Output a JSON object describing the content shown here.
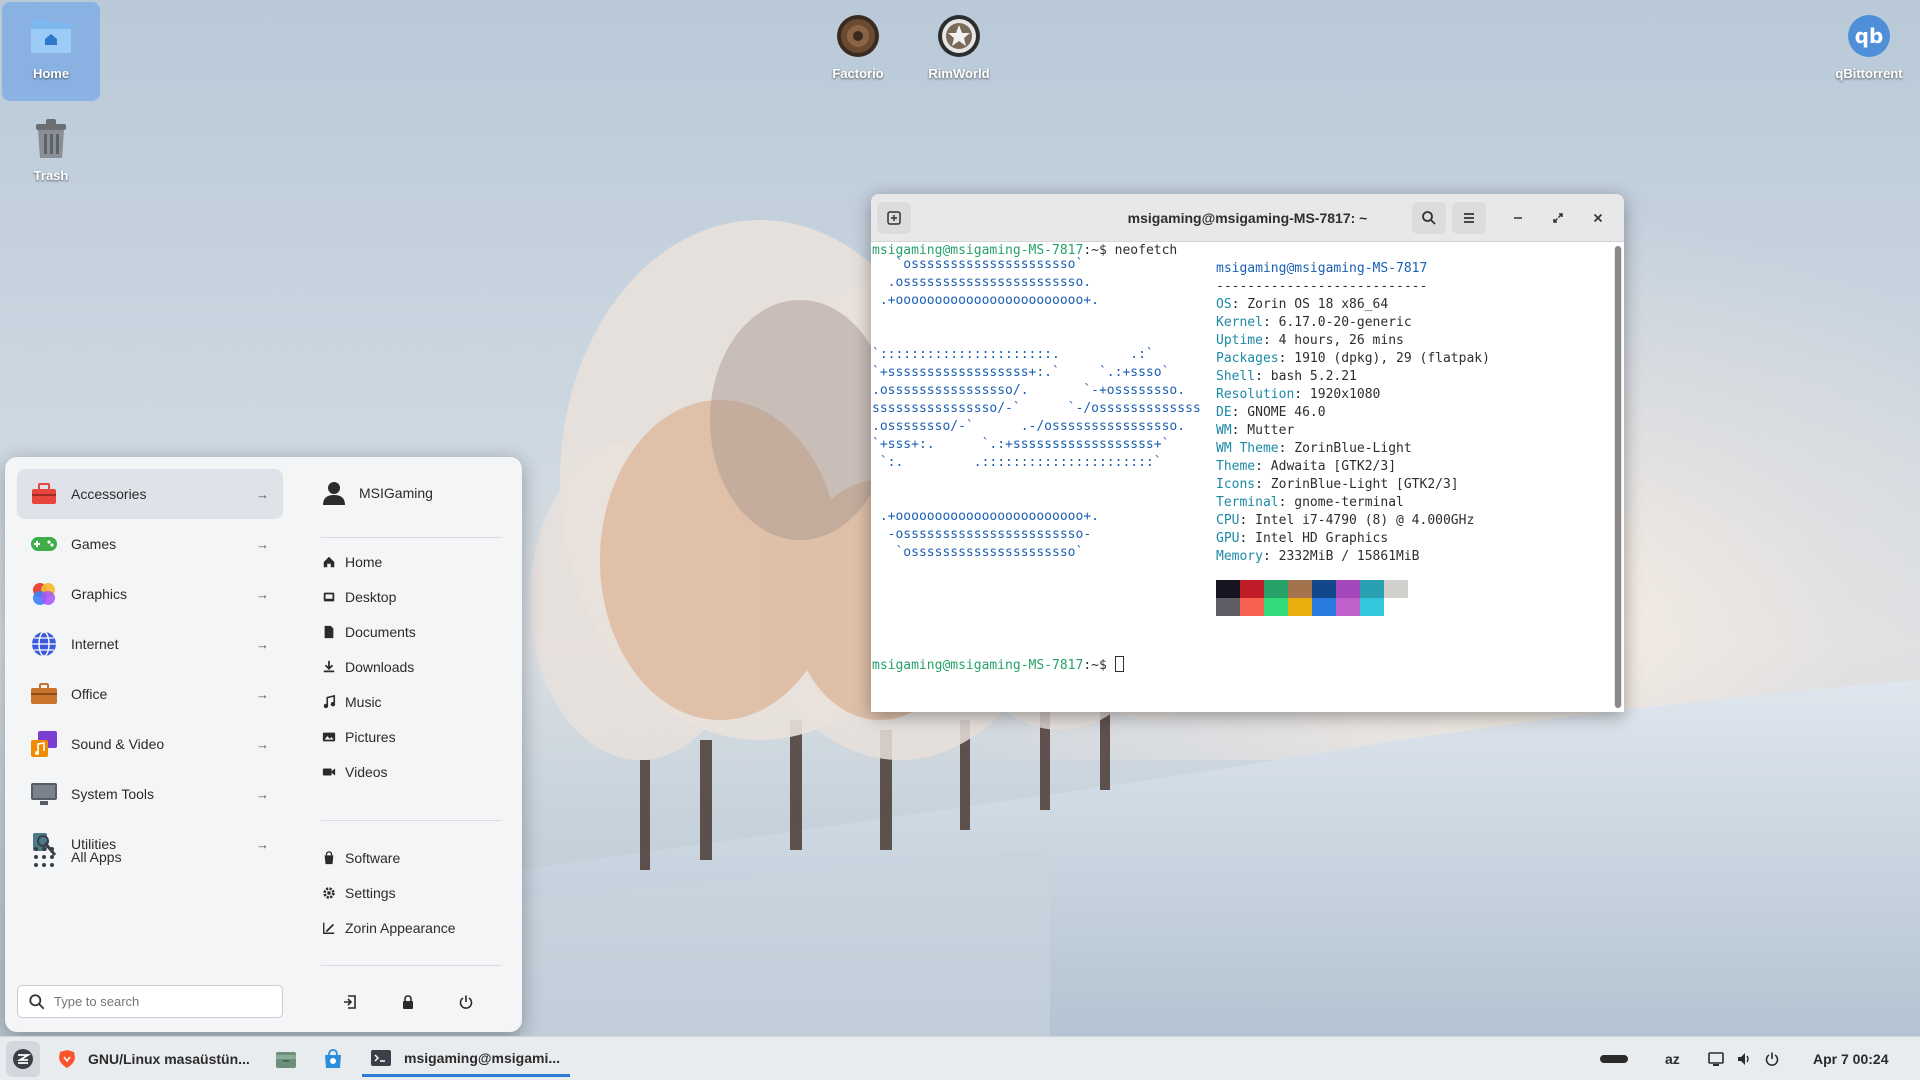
{
  "desktop": {
    "icons": [
      {
        "label": "Home",
        "selected": true
      },
      {
        "label": "Trash"
      },
      {
        "label": "Factorio"
      },
      {
        "label": "RimWorld"
      },
      {
        "label": "qBittorrent"
      }
    ]
  },
  "terminal": {
    "title": "msigaming@msigaming-MS-7817: ~",
    "prompt_user": "msigaming@msigaming-MS-7817",
    "prompt_suffix": ":~$",
    "command": " neofetch",
    "logo_lines": [
      "   `osssssssssssssssssssso`",
      "  .osssssssssssssssssssssso.",
      " .+oooooooooooooooooooooooo+.",
      "",
      "",
      "`::::::::::::::::::::::.         .:`",
      "`+ssssssssssssssssss+:.`     `.:+ssso`",
      ".ossssssssssssssso/.       `-+ossssssso.",
      "ssssssssssssssso/-`      `-/osssssssssssss",
      ".ossssssso/-`      .-/ossssssssssssssso.",
      "`+sss+:.      `.:+ssssssssssssssssss+`",
      " `:.         .::::::::::::::::::::::`",
      "",
      "",
      " .+oooooooooooooooooooooooo+.",
      "  -osssssssssssssssssssssso-",
      "   `osssssssssssssssssssso`"
    ],
    "info_user": "msigaming@msigaming-MS-7817",
    "info_rule": "---------------------------",
    "info": [
      {
        "key": "OS",
        "value": ": Zorin OS 18 x86_64"
      },
      {
        "key": "Kernel",
        "value": ": 6.17.0-20-generic"
      },
      {
        "key": "Uptime",
        "value": ": 4 hours, 26 mins"
      },
      {
        "key": "Packages",
        "value": ": 1910 (dpkg), 29 (flatpak)"
      },
      {
        "key": "Shell",
        "value": ": bash 5.2.21"
      },
      {
        "key": "Resolution",
        "value": ": 1920x1080"
      },
      {
        "key": "DE",
        "value": ": GNOME 46.0"
      },
      {
        "key": "WM",
        "value": ": Mutter"
      },
      {
        "key": "WM Theme",
        "value": ": ZorinBlue-Light"
      },
      {
        "key": "Theme",
        "value": ": Adwaita [GTK2/3]"
      },
      {
        "key": "Icons",
        "value": ": ZorinBlue-Light [GTK2/3]"
      },
      {
        "key": "Terminal",
        "value": ": gnome-terminal"
      },
      {
        "key": "CPU",
        "value": ": Intel i7-4790 (8) @ 4.000GHz"
      },
      {
        "key": "GPU",
        "value": ": Intel HD Graphics"
      },
      {
        "key": "Memory",
        "value": ": 2332MiB / 15861MiB"
      }
    ],
    "palette_top": [
      "#171421",
      "#c01c28",
      "#26a269",
      "#a2734c",
      "#12488b",
      "#a347ba",
      "#2aa1b3",
      "#d0cfcc"
    ],
    "palette_bottom": [
      "#5e5c64",
      "#f66151",
      "#33da7a",
      "#e9ad0c",
      "#2a7bde",
      "#c061cb",
      "#33c7de",
      "#ffffff"
    ]
  },
  "menu": {
    "categories": [
      {
        "label": "Accessories",
        "icon": "toolbox-icon",
        "color": "#e8453c"
      },
      {
        "label": "Games",
        "icon": "gamepad-icon",
        "color": "#3fae49"
      },
      {
        "label": "Graphics",
        "icon": "graphics-icon",
        "color": "#f39c12"
      },
      {
        "label": "Internet",
        "icon": "globe-icon",
        "color": "#3b5bdb"
      },
      {
        "label": "Office",
        "icon": "briefcase-icon",
        "color": "#c8742c"
      },
      {
        "label": "Sound & Video",
        "icon": "music-icon",
        "color": "#f08c00"
      },
      {
        "label": "System Tools",
        "icon": "monitor-icon",
        "color": "#555c66"
      },
      {
        "label": "Utilities",
        "icon": "utilities-icon",
        "color": "#4a7a8c"
      }
    ],
    "all_apps": "All Apps",
    "search_placeholder": "Type to search",
    "user": "MSIGaming",
    "places": [
      "Home",
      "Desktop",
      "Documents",
      "Downloads",
      "Music",
      "Pictures",
      "Videos"
    ],
    "system": [
      "Software",
      "Settings",
      "Zorin Appearance"
    ]
  },
  "taskbar": {
    "browser_window": "GNU/Linux masaüstün...",
    "terminal_window": "msigaming@msigami...",
    "keyboard_layout": "az",
    "clock": "Apr 7  00:24",
    "accent": "#2a7fd4"
  }
}
